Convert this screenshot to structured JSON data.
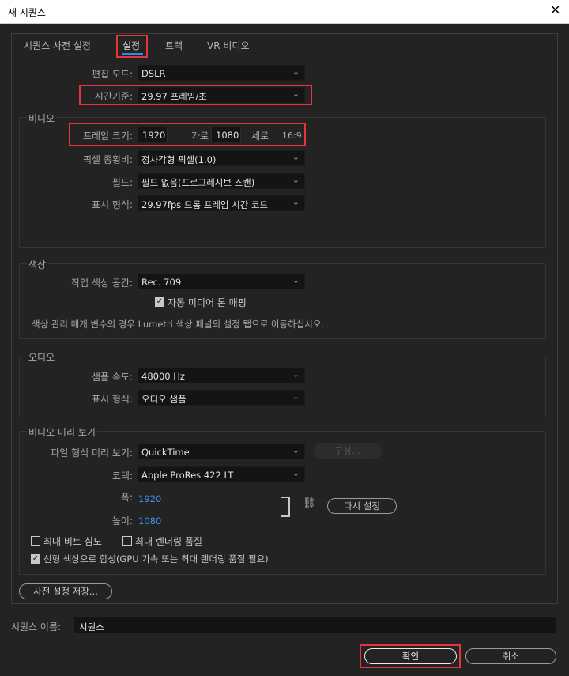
{
  "window": {
    "title": "새 시퀀스",
    "close_glyph": "✕"
  },
  "tabs": [
    {
      "label": "시퀀스 사전 설정"
    },
    {
      "label": "설정"
    },
    {
      "label": "트랙"
    },
    {
      "label": "VR 비디오"
    }
  ],
  "edit_mode": {
    "label": "편집 모드:",
    "value": "DSLR"
  },
  "timebase": {
    "label": "시간기준:",
    "value": "29.97  프레임/초"
  },
  "video": {
    "section": "비디오",
    "frame_size_label": "프레임 크기:",
    "width": "1920",
    "width_label": "가로",
    "height": "1080",
    "height_label": "세로",
    "aspect": "16:9",
    "pixel_aspect": {
      "label": "픽셀 종횡비:",
      "value": "정사각형 픽셀(1.0)"
    },
    "fields": {
      "label": "필드:",
      "value": "필드 없음(프로그레시브 스캔)"
    },
    "display_format": {
      "label": "표시 형식:",
      "value": "29.97fps 드롭 프레임 시간 코드"
    }
  },
  "color": {
    "section": "색상",
    "working_space": {
      "label": "작업 색상 공간:",
      "value": "Rec. 709"
    },
    "auto_tone_map": {
      "label": "자동 미디어 톤 매핑",
      "checked": true
    },
    "note": "색상 관리 매개 변수의 경우 Lumetri 색상 패널의 설정 탭으로 이동하십시오."
  },
  "audio": {
    "section": "오디오",
    "sample_rate": {
      "label": "샘플 속도:",
      "value": "48000 Hz"
    },
    "display_format": {
      "label": "표시 형식:",
      "value": "오디오 샘플"
    }
  },
  "preview": {
    "section": "비디오 미리 보기",
    "file_format": {
      "label": "파일 형식 미리 보기:",
      "value": "QuickTime"
    },
    "configure_label": "구성...",
    "codec": {
      "label": "코덱:",
      "value": "Apple ProRes 422 LT"
    },
    "width_label": "폭:",
    "width_value": "1920",
    "height_label": "높이:",
    "height_value": "1080",
    "reset_label": "다시 설정"
  },
  "options": {
    "max_bit_depth": {
      "label": "최대 비트 심도",
      "checked": false
    },
    "max_render_quality": {
      "label": "최대 렌더링 품질",
      "checked": false
    },
    "linear_color": {
      "label": "선형 색상으로 합성(GPU 가속 또는 최대 렌더링 품질 필요)",
      "checked": true
    }
  },
  "save_preset_label": "사전 설정 저장...",
  "sequence_name": {
    "label": "시퀀스 이름:",
    "value": "시퀀스"
  },
  "buttons": {
    "ok": "확인",
    "cancel": "취소"
  },
  "colors": {
    "accent": "#2d8ceb",
    "highlight_box": "#e8343c",
    "link_value": "#3a93e6"
  }
}
